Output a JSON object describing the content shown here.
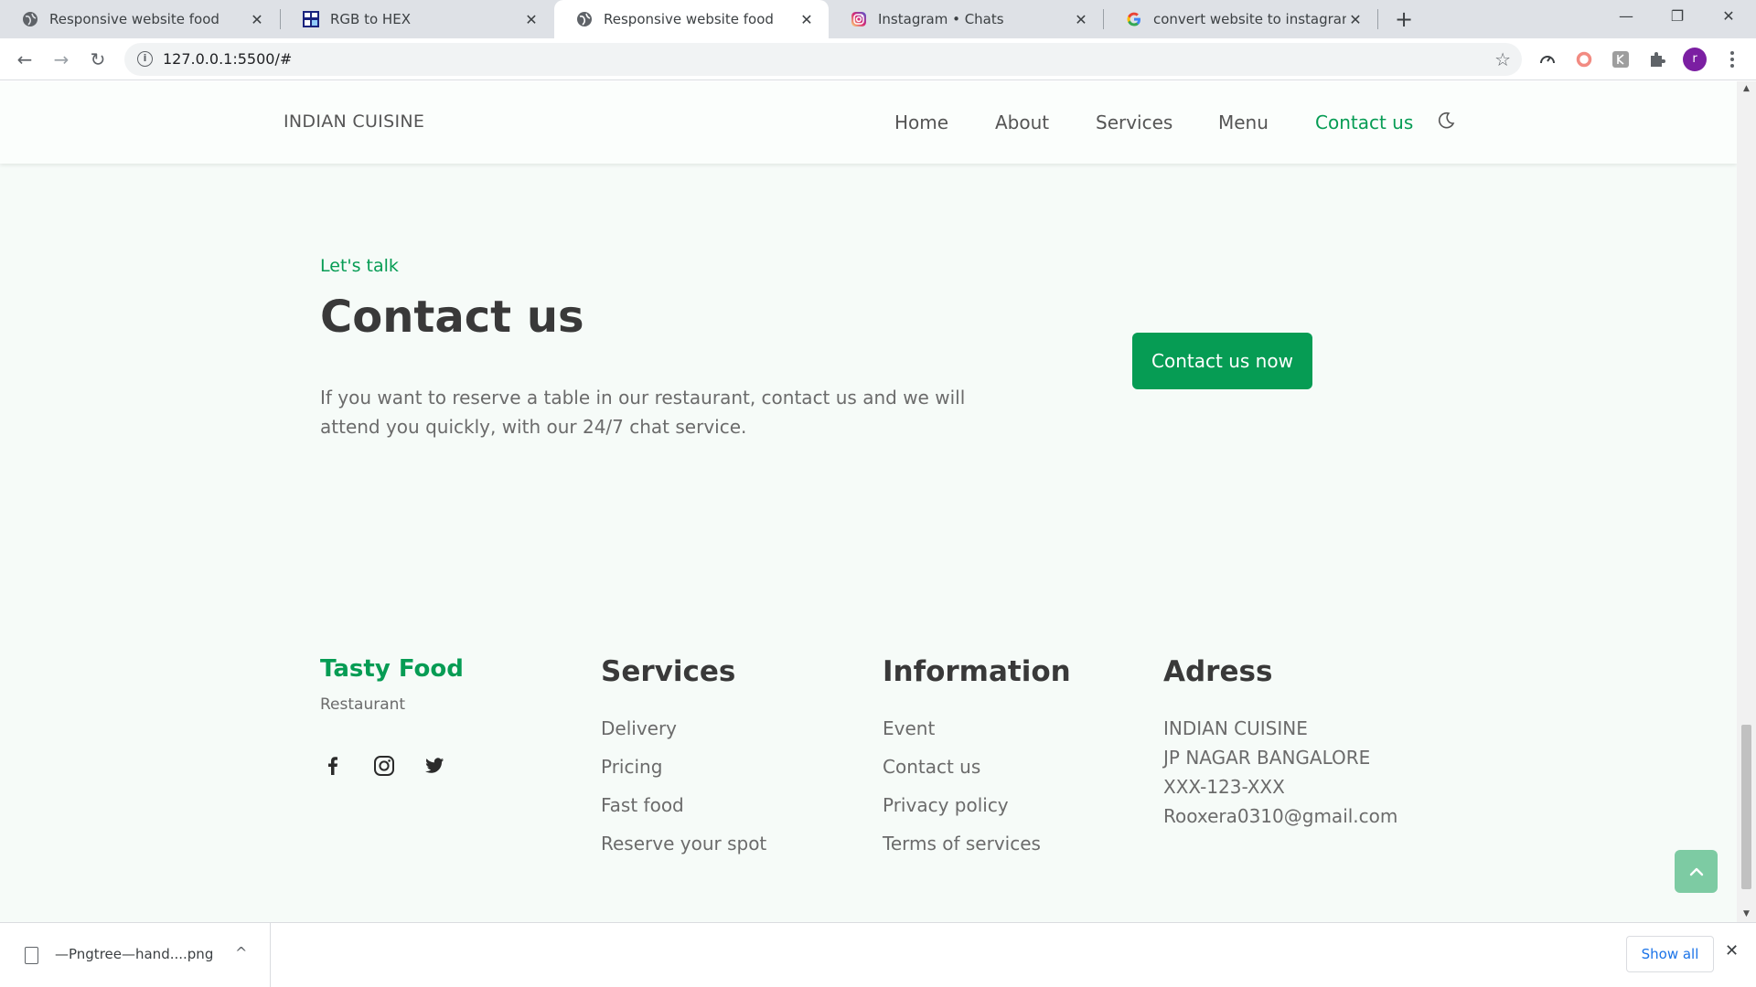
{
  "browser": {
    "tabs": [
      {
        "title": "Responsive website food",
        "icon": "globe-icon",
        "active": false
      },
      {
        "title": "RGB to HEX",
        "icon": "rgb-to-hex-favicon",
        "active": false
      },
      {
        "title": "Responsive website food",
        "icon": "globe-icon",
        "active": true
      },
      {
        "title": "Instagram • Chats",
        "icon": "instagram-icon",
        "active": false
      },
      {
        "title": "convert website to instagram pos",
        "icon": "google-icon",
        "active": false
      }
    ],
    "close_glyph": "✕",
    "new_tab_glyph": "+",
    "window_controls": {
      "minimize": "—",
      "maximize": "❐",
      "close": "✕"
    },
    "toolbar": {
      "back": "←",
      "forward": "→",
      "reload": "↻",
      "url": "127.0.0.1:5500/#",
      "info": "i",
      "bookmark": "☆",
      "profile_initial": "r"
    }
  },
  "site": {
    "logo": "INDIAN CUISINE",
    "nav": [
      {
        "label": "Home",
        "active": false
      },
      {
        "label": "About",
        "active": false
      },
      {
        "label": "Services",
        "active": false
      },
      {
        "label": "Menu",
        "active": false
      },
      {
        "label": "Contact us",
        "active": true
      }
    ],
    "contact": {
      "eyebrow": "Let's talk",
      "title": "Contact us",
      "description": "If you want to reserve a table in our restaurant, contact us and we will attend you quickly, with our 24/7 chat service.",
      "button": "Contact us now"
    },
    "footer": {
      "brand": "Tasty Food",
      "brand_sub": "Restaurant",
      "social": [
        "facebook-icon",
        "instagram-icon",
        "twitter-icon"
      ],
      "columns": [
        {
          "title": "Services",
          "items": [
            "Delivery",
            "Pricing",
            "Fast food",
            "Reserve your spot"
          ]
        },
        {
          "title": "Information",
          "items": [
            "Event",
            "Contact us",
            "Privacy policy",
            "Terms of services"
          ]
        },
        {
          "title": "Adress",
          "items": [
            "INDIAN CUISINE",
            "JP NAGAR BANGALORE",
            "XXX-123-XXX",
            "Rooxera0310@gmail.com"
          ]
        }
      ]
    },
    "colors": {
      "accent": "#069c54",
      "background": "#f6fbf8",
      "heading": "#393939",
      "text": "#6b6b6b"
    }
  },
  "downloads": {
    "file": "—Pngtree—hand....png",
    "show_all": "Show all",
    "chevron": "^",
    "close": "✕"
  }
}
